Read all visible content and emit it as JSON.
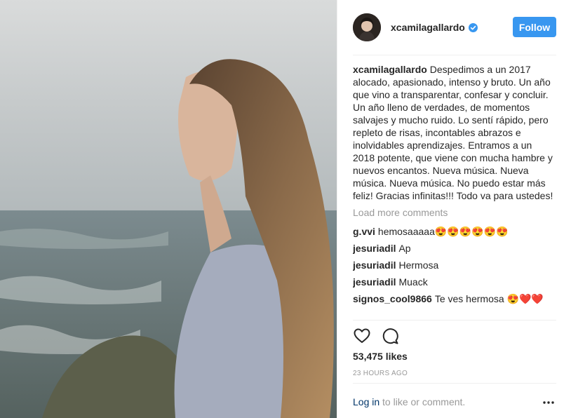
{
  "post": {
    "username": "xcamilagallardo",
    "follow_label": "Follow",
    "caption_author": "xcamilagallardo",
    "caption_text": "Despedimos a un 2017 alocado, apasionado, intenso y bruto. Un año que vino a transparentar, confesar y concluir. Un año lleno de verdades, de momentos salvajes y mucho ruido. Lo sentí rápido, pero repleto de risas, incontables abrazos e inolvidables aprendizajes. Entramos a un 2018 potente, que viene con mucha hambre y nuevos encantos. Nueva música. Nueva música. Nueva música. No puedo estar más feliz! Gracias infinitas!!! Todo va para ustedes!",
    "load_more": "Load more comments",
    "comments": [
      {
        "author": "g.vvi",
        "text": "hemosaaaaa😍😍😍😍😍😍"
      },
      {
        "author": "jesuriadil",
        "text": "Ap"
      },
      {
        "author": "jesuriadil",
        "text": "Hermosa"
      },
      {
        "author": "jesuriadil",
        "text": "Muack"
      },
      {
        "author": "signos_cool9866",
        "text": "Te ves hermosa 😍❤️❤️"
      }
    ],
    "likes": "53,475 likes",
    "timestamp": "23 HOURS AGO",
    "login_link": "Log in",
    "login_rest": " to like or comment."
  },
  "colors": {
    "accent": "#3897f0",
    "link": "#003569",
    "muted": "#999999"
  },
  "icons": [
    "verified-badge-icon",
    "heart-icon",
    "comment-icon",
    "more-options-icon"
  ]
}
